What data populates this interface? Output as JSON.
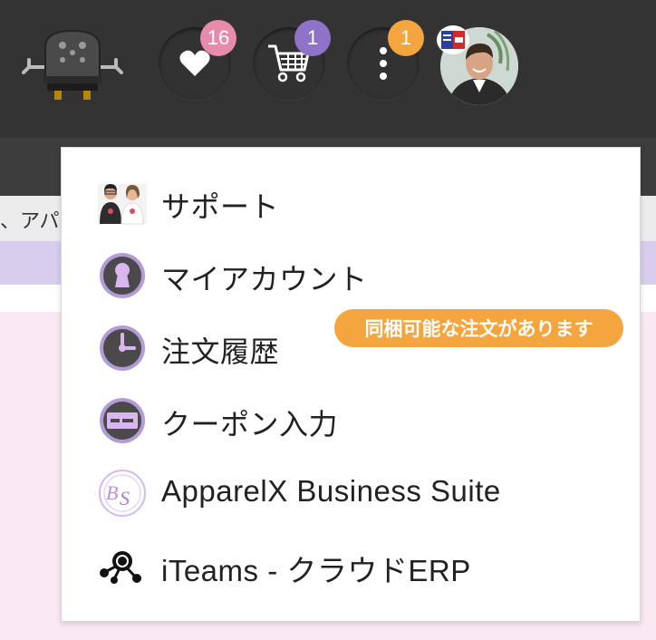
{
  "header": {
    "favorites": {
      "icon": "heart-icon",
      "count": "16",
      "badge_color": "#e88aac"
    },
    "cart": {
      "icon": "cart-icon",
      "count": "1",
      "badge_color": "#8e73c9"
    },
    "more": {
      "icon": "vertical-dots-icon",
      "count": "1",
      "badge_color": "#f4a53e"
    },
    "avatar": {
      "icon": "user-avatar"
    }
  },
  "breadcrumb": {
    "text": "、アパ"
  },
  "menu": {
    "items": [
      {
        "label": "サポート",
        "icon": "support-staff-icon"
      },
      {
        "label": "マイアカウント",
        "icon": "keyhole-icon"
      },
      {
        "label": "注文履歴",
        "icon": "clock-icon"
      },
      {
        "label": "クーポン入力",
        "icon": "coupon-card-icon"
      },
      {
        "label": "ApparelX Business Suite",
        "icon": "bs-logo-icon"
      },
      {
        "label": "iTeams - クラウドERP",
        "icon": "network-nodes-icon"
      }
    ],
    "notice": "同梱可能な注文があります"
  },
  "colors": {
    "topbar": "#333333",
    "accent_purple": "#8e73c9",
    "notice_orange": "#f4a53e"
  }
}
